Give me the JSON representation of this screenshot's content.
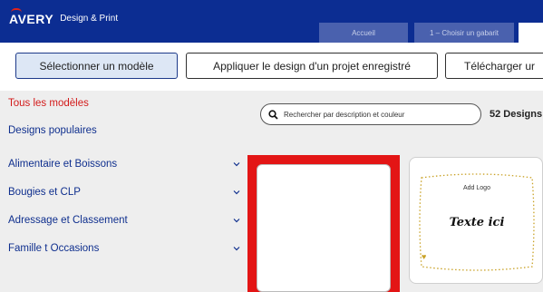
{
  "header": {
    "logo": "AVERY",
    "app_name": "Design & Print",
    "tabs": [
      {
        "label": "Accueil"
      },
      {
        "label": "1 – Choisir un gabarit"
      },
      {
        "label": ""
      }
    ],
    "bg_color": "#0c2d92"
  },
  "actions": {
    "select_model": "Sélectionner un modèle",
    "apply_saved": "Appliquer le design d'un projet enregistré",
    "upload": "Télécharger ur"
  },
  "sidebar": {
    "items": [
      {
        "label": "Tous les modèles",
        "active": true,
        "expandable": false
      },
      {
        "label": "Designs populaires",
        "active": false,
        "expandable": false
      },
      {
        "label": "Alimentaire et Boissons",
        "active": false,
        "expandable": true
      },
      {
        "label": "Bougies et CLP",
        "active": false,
        "expandable": true
      },
      {
        "label": "Adressage et Classement",
        "active": false,
        "expandable": true
      },
      {
        "label": "Famille t Occasions",
        "active": false,
        "expandable": true
      }
    ],
    "active_color": "#d31a1a",
    "link_color": "#0f2f8e"
  },
  "main": {
    "search": {
      "placeholder": "Rechercher par description et couleur",
      "icon": "search-icon"
    },
    "count_label": "52 Designs",
    "templates": [
      {
        "label": "",
        "selected": true,
        "highlight_color": "#e31515"
      },
      {
        "add_logo": "Add Logo",
        "text": "Texte ici",
        "icon": "heart-icon"
      }
    ]
  }
}
